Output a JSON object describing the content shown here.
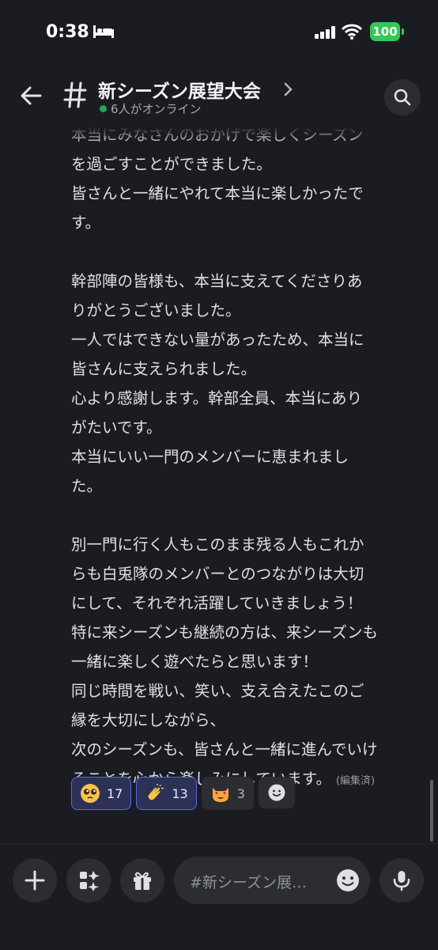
{
  "status_bar": {
    "time": "0:38",
    "battery": "100"
  },
  "header": {
    "channel_name": "新シーズン展望大会",
    "online_text": "6人がオンライン"
  },
  "message": {
    "lines": [
      "本当にみなさんのおかげで楽しくシーズン",
      "を過ごすことができました。",
      "皆さんと一緒にやれて本当に楽しかったで",
      "す。",
      "",
      "幹部陣の皆様も、本当に支えてくださりあ",
      "りがとうございました。",
      "一人ではできない量があったため、本当に",
      "皆さんに支えられました。",
      "心より感謝します。幹部全員、本当にあり",
      "がたいです。",
      "本当にいい一門のメンバーに恵まれまし",
      "た。",
      "",
      "別一門に行く人もこのまま残る人もこれか",
      "らも白兎隊のメンバーとのつながりは大切",
      "にして、それぞれ活躍していきましょう！",
      "特に来シーズンも継続の方は、来シーズンも",
      "一緒に楽しく遊べたらと思います！",
      "同じ時間を戦い、笑い、支え合えたこのご",
      "縁を大切にしながら、",
      "次のシーズンも、皆さんと一緒に進んでいけ",
      "ることを心から楽しみにしています。"
    ],
    "edited_label": "(編集済)"
  },
  "reactions": [
    {
      "emoji": "pleading-face",
      "count": "17",
      "selected": true
    },
    {
      "emoji": "clapping-hands",
      "count": "13",
      "selected": true
    },
    {
      "emoji": "heart-eyes-cat",
      "count": "3",
      "selected": false
    }
  ],
  "composer": {
    "placeholder": "#新シーズン展…"
  },
  "colors": {
    "online": "#23a55a",
    "selected_reaction_border": "#5865f2",
    "battery": "#34c759"
  }
}
